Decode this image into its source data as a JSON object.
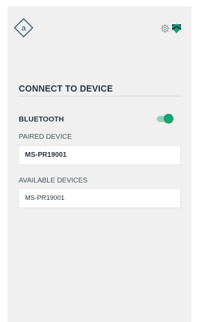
{
  "header": {
    "logo_letter": "a",
    "settings_icon": "gear-icon",
    "brand_icon": "shield-chevron-icon"
  },
  "page": {
    "title": "CONNECT TO DEVICE"
  },
  "bluetooth": {
    "label": "BLUETOOTH",
    "enabled": true
  },
  "paired": {
    "label": "PAIRED DEVICE",
    "device": "MS-PR19001"
  },
  "available": {
    "label": "AVAILABLE DEVICES",
    "devices": [
      "MS-PR19001"
    ]
  },
  "colors": {
    "background": "#eff0ef",
    "text": "#2b3440",
    "toggle_on": "#17a36f",
    "brand_green": "#1aa068",
    "brand_navy": "#1d3a5f"
  }
}
